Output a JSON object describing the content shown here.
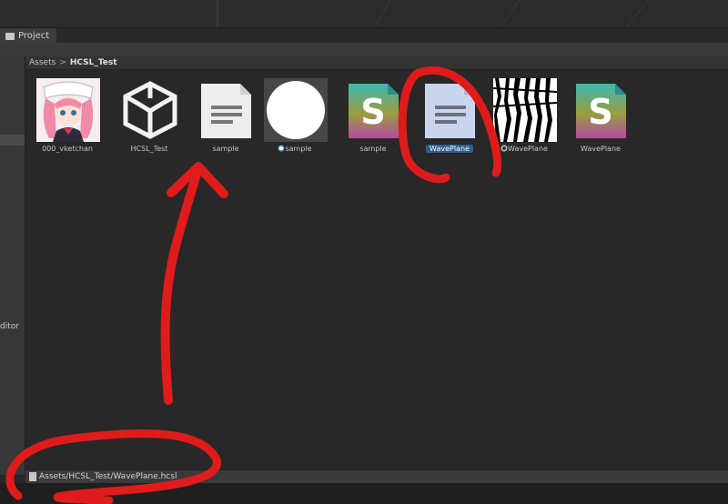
{
  "window": {
    "tab_label": "Project"
  },
  "left_panel": {
    "items": [
      "ditor"
    ]
  },
  "breadcrumb": {
    "root": "Assets",
    "separator": ">",
    "current": "HCSL_Test"
  },
  "assets": [
    {
      "name": "000_vketchan",
      "icon": "avatar-image-icon"
    },
    {
      "name": "HCSL_Test",
      "icon": "unity-cube-icon"
    },
    {
      "name": "sample",
      "icon": "text-document-icon"
    },
    {
      "name": "sample",
      "icon": "material-sphere-icon"
    },
    {
      "name": "sample",
      "icon": "shader-s-icon"
    },
    {
      "name": "WavePlane",
      "icon": "text-document-icon",
      "selected": true
    },
    {
      "name": "WavePlane",
      "icon": "wave-texture-icon"
    },
    {
      "name": "WavePlane",
      "icon": "shader-s-icon"
    }
  ],
  "statusbar": {
    "path": "Assets/HCSL_Test/WavePlane.hcsl"
  },
  "colors": {
    "selection": "#2d5d8f",
    "annotation": "#e01b1b"
  }
}
